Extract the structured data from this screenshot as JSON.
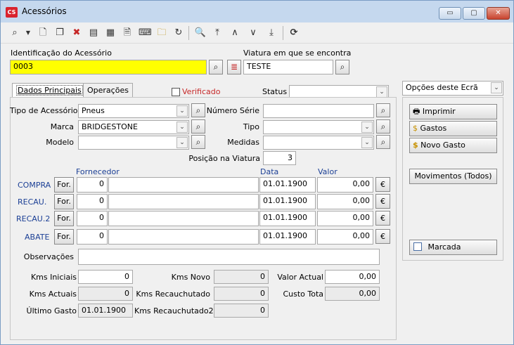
{
  "window": {
    "icon_text": "CS",
    "title": "Acessórios",
    "btn_min": "▭",
    "btn_max": "▢",
    "btn_close": "✕"
  },
  "toolbar": {
    "icons": [
      "search-icon",
      "dropdown-arrow-icon",
      "new-document-icon",
      "copy-icon",
      "delete-icon",
      "form-icon",
      "table-icon",
      "new-item-icon",
      "keyboard-icon",
      "folder-search-icon",
      "refresh-icon",
      "print-preview-icon",
      "first-record-icon",
      "previous-record-icon",
      "next-record-icon",
      "last-record-icon",
      "reload-icon"
    ]
  },
  "header": {
    "id_label": "Identificação do Acessório",
    "id_value": "0003",
    "vehicle_label": "Viatura em que se encontra",
    "vehicle_value": "TESTE"
  },
  "tabs": [
    {
      "label": "Dados Principais"
    },
    {
      "label": "Operações"
    }
  ],
  "verified": {
    "label": "Verificado",
    "checked": false
  },
  "status": {
    "label": "Status",
    "value": ""
  },
  "fields": {
    "tipo_label": "Tipo de Acessório",
    "tipo_value": "Pneus",
    "marca_label": "Marca",
    "marca_value": "BRIDGESTONE",
    "modelo_label": "Modelo",
    "modelo_value": "",
    "serie_label": "Número Série",
    "serie_value": "",
    "tipo2_label": "Tipo",
    "tipo2_value": "",
    "medidas_label": "Medidas",
    "medidas_value": "",
    "posicao_label": "Posição na Viatura",
    "posicao_value": "3"
  },
  "grid": {
    "col_fornecedor": "Fornecedor",
    "col_data": "Data",
    "col_valor": "Valor",
    "rows": [
      {
        "label": "COMPRA",
        "btn": "For.",
        "code": "0",
        "name": "",
        "date": "01.01.1900",
        "value": "0,00",
        "euro": "€"
      },
      {
        "label": "RECAU.",
        "btn": "For.",
        "code": "0",
        "name": "",
        "date": "01.01.1900",
        "value": "0,00",
        "euro": "€"
      },
      {
        "label": "RECAU.2",
        "btn": "For.",
        "code": "0",
        "name": "",
        "date": "01.01.1900",
        "value": "0,00",
        "euro": "€"
      },
      {
        "label": "ABATE",
        "btn": "For.",
        "code": "0",
        "name": "",
        "date": "01.01.1900",
        "value": "0,00",
        "euro": "€"
      }
    ]
  },
  "obs": {
    "label": "Observações",
    "value": ""
  },
  "kms": {
    "iniciais_label": "Kms Iniciais",
    "iniciais_value": "0",
    "actuais_label": "Kms Actuais",
    "actuais_value": "0",
    "ultimo_label": "Último Gasto",
    "ultimo_value": "01.01.1900",
    "novo_label": "Kms Novo",
    "novo_value": "0",
    "recau_label": "Kms Recauchutado",
    "recau_value": "0",
    "recau2_label": "Kms Recauchutado2",
    "recau2_value": "0",
    "valor_label": "Valor Actual",
    "valor_value": "0,00",
    "custo_label": "Custo Tota",
    "custo_value": "0,00"
  },
  "right": {
    "options_label": "Opções deste Ecrã",
    "imprimir": "Imprimir",
    "gastos": "Gastos",
    "novo_gasto": "Novo Gasto",
    "movimentos": "Movimentos (Todos)",
    "marcada": "Marcada",
    "marcada_checked": false
  }
}
